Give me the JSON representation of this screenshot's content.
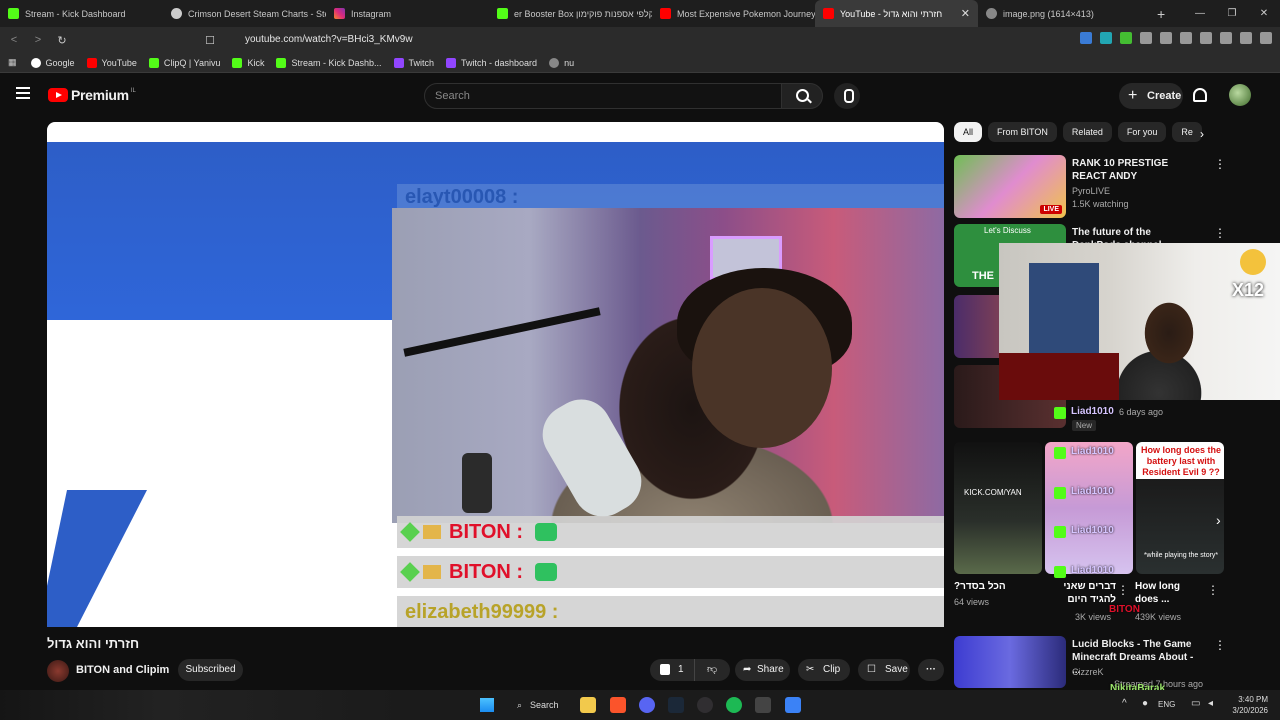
{
  "browser": {
    "tabs": [
      {
        "label": "Stream - Kick Dashboard",
        "color": "#53fc18"
      },
      {
        "label": "Crimson Desert Steam Charts - Stea",
        "color": "#cccccc"
      },
      {
        "label": "Instagram",
        "color": "#e1306c"
      },
      {
        "label": "er Booster Box קלפי אספנות פוקימון",
        "color": "#53fc18"
      },
      {
        "label": "Most Expensive Pokemon Journey T",
        "color": "#ff0000"
      },
      {
        "label": "YouTube - חזרתי והוא גדול",
        "color": "#ff0000",
        "active": true
      },
      {
        "label": "image.png (1614×413)",
        "color": "#aaaaaa"
      }
    ],
    "url": "youtube.com/watch?v=BHci3_KMv9w",
    "bookmarks": [
      {
        "label": "Google",
        "color": "#4285f4"
      },
      {
        "label": "YouTube",
        "color": "#ff0000"
      },
      {
        "label": "ClipQ | Yanivu",
        "color": "#53fc18"
      },
      {
        "label": "Kick",
        "color": "#53fc18"
      },
      {
        "label": "Stream - Kick Dashb...",
        "color": "#53fc18"
      },
      {
        "label": "Twitch",
        "color": "#9146ff"
      },
      {
        "label": "Twitch - dashboard",
        "color": "#9146ff"
      },
      {
        "label": "nu",
        "color": "#cccccc"
      }
    ]
  },
  "youtube": {
    "logo_text": "Premium",
    "logo_sup": "IL",
    "search_placeholder": "Search",
    "create_label": "Create"
  },
  "video": {
    "chat_top": "elayt00008 :",
    "chat_lines": [
      "BITON :",
      "BITON :",
      "elizabeth99999 :"
    ],
    "title": "חזרתי והוא גדול",
    "channel": "BITON and Clipim",
    "subscribed_label": "Subscribed",
    "likes": "1",
    "share_label": "Share",
    "clip_label": "Clip",
    "save_label": "Save"
  },
  "sidebar": {
    "chips": [
      "All",
      "From BITON",
      "Related",
      "For you",
      "Re"
    ],
    "recs": [
      {
        "title": "RANK 10 PRESTIGE REACT ANDY",
        "channel": "PyroLIVE",
        "meta": "1.5K watching",
        "live": "LIVE"
      },
      {
        "title": "The future of the DankPods channel",
        "thumb_text": "Let's Discuss",
        "thumb_sub": "THE"
      },
      {
        "title": "Lucid Blocks - The Game Minecraft Dreams About - ...",
        "channel": "CizzreK",
        "meta": "Streamed 7 hours ago"
      }
    ],
    "overlay_name": "Liad1010",
    "overlay_meta": "6 days ago",
    "overlay_new": "New",
    "x12": "X12",
    "shelf": [
      {
        "cap": "?הכל בסדר",
        "sub": "64 views"
      },
      {
        "cap": "דברים שאני להגיד היום",
        "sub": "3K views"
      },
      {
        "cap": "How long does ...",
        "sub": "439K views",
        "thumb": "How long does the battery last with Resident Evil 9 ??",
        "thumb_sub": "*while playing the story*"
      }
    ],
    "shelf_kick": "KICK.COM/YAN",
    "kick_names": [
      "Liad1010",
      "Liad1010",
      "Liad1010",
      "Liad1010",
      "BITON",
      "NikitaBarak"
    ]
  },
  "taskbar": {
    "search_label": "Search",
    "lang": "ENG",
    "time": "3:40 PM",
    "date": "3/20/2026"
  }
}
